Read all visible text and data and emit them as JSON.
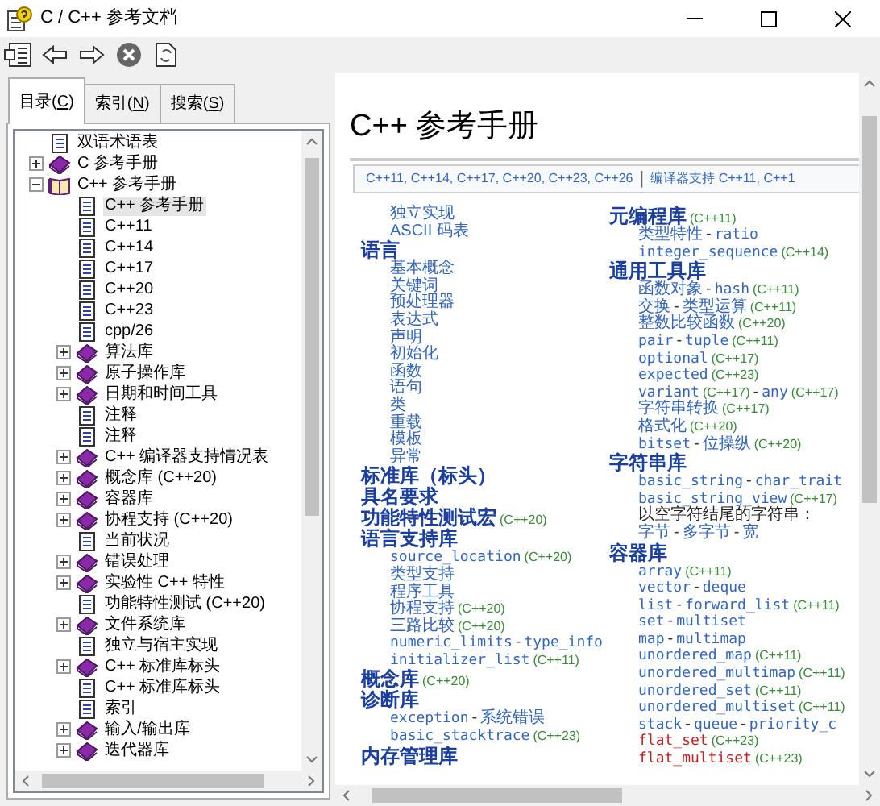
{
  "window": {
    "title": "C / C++ 参考文档"
  },
  "toolbar": {
    "buttons": [
      {
        "kind": "hide"
      },
      {
        "kind": "back"
      },
      {
        "kind": "forward"
      },
      {
        "kind": "stop"
      },
      {
        "kind": "refresh"
      }
    ]
  },
  "tabs": [
    {
      "before": "目录(",
      "key": "C",
      "after": ")",
      "selected": true
    },
    {
      "before": "索引(",
      "key": "N",
      "after": ")",
      "selected": false
    },
    {
      "before": "搜索(",
      "key": "S",
      "after": ")",
      "selected": false
    }
  ],
  "tree": [
    {
      "label": "双语术语表",
      "kind": "page",
      "selected": false
    },
    {
      "label": "C 参考手册",
      "kind": "book",
      "expanded": false,
      "selected": false
    },
    {
      "label": "C++ 参考手册",
      "kind": "book",
      "expanded": true,
      "selected": false,
      "children": [
        {
          "label": "C++ 参考手册",
          "kind": "page",
          "selected": true
        },
        {
          "label": "C++11",
          "kind": "page",
          "selected": false
        },
        {
          "label": "C++14",
          "kind": "page",
          "selected": false
        },
        {
          "label": "C++17",
          "kind": "page",
          "selected": false
        },
        {
          "label": "C++20",
          "kind": "page",
          "selected": false
        },
        {
          "label": "C++23",
          "kind": "page",
          "selected": false
        },
        {
          "label": "cpp/26",
          "kind": "page",
          "selected": false
        },
        {
          "label": "算法库",
          "kind": "book",
          "expanded": false,
          "selected": false
        },
        {
          "label": "原子操作库",
          "kind": "book",
          "expanded": false,
          "selected": false
        },
        {
          "label": "日期和时间工具",
          "kind": "book",
          "expanded": false,
          "selected": false
        },
        {
          "label": "注释",
          "kind": "page",
          "selected": false
        },
        {
          "label": "注释",
          "kind": "page",
          "selected": false
        },
        {
          "label": "C++ 编译器支持情况表",
          "kind": "book",
          "expanded": false,
          "selected": false
        },
        {
          "label": "概念库 (C++20)",
          "kind": "book",
          "expanded": false,
          "selected": false
        },
        {
          "label": "容器库",
          "kind": "book",
          "expanded": false,
          "selected": false
        },
        {
          "label": "协程支持 (C++20)",
          "kind": "book",
          "expanded": false,
          "selected": false
        },
        {
          "label": "当前状况",
          "kind": "page",
          "selected": false
        },
        {
          "label": "错误处理",
          "kind": "book",
          "expanded": false,
          "selected": false
        },
        {
          "label": "实验性 C++ 特性",
          "kind": "book",
          "expanded": false,
          "selected": false
        },
        {
          "label": "功能特性测试 (C++20)",
          "kind": "page",
          "selected": false
        },
        {
          "label": "文件系统库",
          "kind": "book",
          "expanded": false,
          "selected": false
        },
        {
          "label": "独立与宿主实现",
          "kind": "page",
          "selected": false
        },
        {
          "label": "C++ 标准库标头",
          "kind": "book",
          "expanded": false,
          "selected": false
        },
        {
          "label": "C++ 标准库标头",
          "kind": "page",
          "selected": false
        },
        {
          "label": "索引",
          "kind": "page",
          "selected": false
        },
        {
          "label": "输入/输出库",
          "kind": "book",
          "expanded": false,
          "selected": false
        },
        {
          "label": "迭代器库",
          "kind": "book",
          "expanded": false,
          "selected": false
        }
      ]
    }
  ],
  "page": {
    "title": "C++ 参考手册",
    "nav": {
      "versions": "C++11, C++14, C++17, C++20, C++23, C++26",
      "separator": "|",
      "compiler": "编译器支持 C++11, C++1"
    },
    "columns": [
      [
        {
          "kind": "item",
          "parts": [
            {
              "text": "独立实现",
              "kind": "link"
            }
          ]
        },
        {
          "kind": "item",
          "parts": [
            {
              "text": "ASCII 码表",
              "kind": "link"
            }
          ]
        },
        {
          "kind": "heading",
          "parts": [
            {
              "text": "语言",
              "kind": "link"
            }
          ]
        },
        {
          "kind": "item",
          "parts": [
            {
              "text": "基本概念",
              "kind": "link"
            }
          ]
        },
        {
          "kind": "item",
          "parts": [
            {
              "text": "关键词",
              "kind": "link"
            }
          ]
        },
        {
          "kind": "item",
          "parts": [
            {
              "text": "预处理器",
              "kind": "link"
            }
          ]
        },
        {
          "kind": "item",
          "parts": [
            {
              "text": "表达式",
              "kind": "link"
            }
          ]
        },
        {
          "kind": "item",
          "parts": [
            {
              "text": "声明",
              "kind": "link"
            }
          ]
        },
        {
          "kind": "item",
          "parts": [
            {
              "text": "初始化",
              "kind": "link"
            }
          ]
        },
        {
          "kind": "item",
          "parts": [
            {
              "text": "函数",
              "kind": "link"
            }
          ]
        },
        {
          "kind": "item",
          "parts": [
            {
              "text": "语句",
              "kind": "link"
            }
          ]
        },
        {
          "kind": "item",
          "parts": [
            {
              "text": "类",
              "kind": "link"
            }
          ]
        },
        {
          "kind": "item",
          "parts": [
            {
              "text": "重载",
              "kind": "link"
            }
          ]
        },
        {
          "kind": "item",
          "parts": [
            {
              "text": "模板",
              "kind": "link"
            }
          ]
        },
        {
          "kind": "item",
          "parts": [
            {
              "text": "异常",
              "kind": "link"
            }
          ]
        },
        {
          "kind": "heading",
          "parts": [
            {
              "text": "标准库（标头）",
              "kind": "link"
            }
          ]
        },
        {
          "kind": "heading",
          "parts": [
            {
              "text": "具名要求",
              "kind": "link"
            }
          ]
        },
        {
          "kind": "heading",
          "parts": [
            {
              "text": "功能特性测试宏",
              "kind": "link"
            },
            {
              "text": "(C++20)",
              "kind": "tag"
            }
          ]
        },
        {
          "kind": "heading",
          "parts": [
            {
              "text": "语言支持库",
              "kind": "link"
            }
          ]
        },
        {
          "kind": "item",
          "parts": [
            {
              "text": "source_location",
              "kind": "code"
            },
            {
              "text": "(C++20)",
              "kind": "tag"
            }
          ]
        },
        {
          "kind": "item",
          "parts": [
            {
              "text": "类型支持",
              "kind": "link"
            }
          ]
        },
        {
          "kind": "item",
          "parts": [
            {
              "text": "程序工具",
              "kind": "link"
            }
          ]
        },
        {
          "kind": "item",
          "parts": [
            {
              "text": "协程支持",
              "kind": "link"
            },
            {
              "text": "(C++20)",
              "kind": "tag"
            }
          ]
        },
        {
          "kind": "item",
          "parts": [
            {
              "text": "三路比较",
              "kind": "link"
            },
            {
              "text": "(C++20)",
              "kind": "tag"
            }
          ]
        },
        {
          "kind": "item",
          "parts": [
            {
              "text": "numeric_limits",
              "kind": "code"
            },
            {
              "text": "-",
              "kind": "sep"
            },
            {
              "text": "type_info",
              "kind": "code"
            }
          ]
        },
        {
          "kind": "item",
          "parts": [
            {
              "text": "initializer_list",
              "kind": "code"
            },
            {
              "text": "(C++11)",
              "kind": "tag"
            }
          ]
        },
        {
          "kind": "heading",
          "parts": [
            {
              "text": "概念库",
              "kind": "link"
            },
            {
              "text": "(C++20)",
              "kind": "tag"
            }
          ]
        },
        {
          "kind": "heading",
          "parts": [
            {
              "text": "诊断库",
              "kind": "link"
            }
          ]
        },
        {
          "kind": "item",
          "parts": [
            {
              "text": "exception",
              "kind": "code"
            },
            {
              "text": "-",
              "kind": "sep"
            },
            {
              "text": "系统错误",
              "kind": "link"
            }
          ]
        },
        {
          "kind": "item",
          "parts": [
            {
              "text": "basic_stacktrace",
              "kind": "code"
            },
            {
              "text": "(C++23)",
              "kind": "tag"
            }
          ]
        },
        {
          "kind": "heading",
          "parts": [
            {
              "text": "内存管理库",
              "kind": "link"
            }
          ]
        }
      ],
      [
        {
          "kind": "heading",
          "parts": [
            {
              "text": "元编程库",
              "kind": "link"
            },
            {
              "text": "(C++11)",
              "kind": "tag"
            }
          ]
        },
        {
          "kind": "item",
          "parts": [
            {
              "text": "类型特性",
              "kind": "link"
            },
            {
              "text": "-",
              "kind": "sep"
            },
            {
              "text": "ratio",
              "kind": "code"
            }
          ]
        },
        {
          "kind": "item",
          "parts": [
            {
              "text": "integer_sequence",
              "kind": "code"
            },
            {
              "text": "(C++14)",
              "kind": "tag"
            }
          ]
        },
        {
          "kind": "heading",
          "parts": [
            {
              "text": "通用工具库",
              "kind": "link"
            }
          ]
        },
        {
          "kind": "item",
          "parts": [
            {
              "text": "函数对象",
              "kind": "link"
            },
            {
              "text": "-",
              "kind": "sep"
            },
            {
              "text": "hash",
              "kind": "code"
            },
            {
              "text": "(C++11)",
              "kind": "tag"
            }
          ]
        },
        {
          "kind": "item",
          "parts": [
            {
              "text": "交换",
              "kind": "link"
            },
            {
              "text": "-",
              "kind": "sep"
            },
            {
              "text": "类型运算",
              "kind": "link"
            },
            {
              "text": "(C++11)",
              "kind": "tag"
            }
          ]
        },
        {
          "kind": "item",
          "parts": [
            {
              "text": "整数比较函数",
              "kind": "link"
            },
            {
              "text": "(C++20)",
              "kind": "tag"
            }
          ]
        },
        {
          "kind": "item",
          "parts": [
            {
              "text": "pair",
              "kind": "code"
            },
            {
              "text": "-",
              "kind": "sep"
            },
            {
              "text": "tuple",
              "kind": "code"
            },
            {
              "text": "(C++11)",
              "kind": "tag"
            }
          ]
        },
        {
          "kind": "item",
          "parts": [
            {
              "text": "optional",
              "kind": "code"
            },
            {
              "text": "(C++17)",
              "kind": "tag"
            }
          ]
        },
        {
          "kind": "item",
          "parts": [
            {
              "text": "expected",
              "kind": "code"
            },
            {
              "text": "(C++23)",
              "kind": "tag"
            }
          ]
        },
        {
          "kind": "item",
          "parts": [
            {
              "text": "variant",
              "kind": "code"
            },
            {
              "text": "(C++17)",
              "kind": "tag"
            },
            {
              "text": "-",
              "kind": "sep"
            },
            {
              "text": "any",
              "kind": "code"
            },
            {
              "text": "(C++17)",
              "kind": "tag"
            }
          ]
        },
        {
          "kind": "item",
          "parts": [
            {
              "text": "字符串转换",
              "kind": "link"
            },
            {
              "text": "(C++17)",
              "kind": "tag"
            }
          ]
        },
        {
          "kind": "item",
          "parts": [
            {
              "text": "格式化",
              "kind": "link"
            },
            {
              "text": "(C++20)",
              "kind": "tag"
            }
          ]
        },
        {
          "kind": "item",
          "parts": [
            {
              "text": "bitset",
              "kind": "code"
            },
            {
              "text": "-",
              "kind": "sep"
            },
            {
              "text": "位操纵",
              "kind": "link"
            },
            {
              "text": "(C++20)",
              "kind": "tag"
            }
          ]
        },
        {
          "kind": "heading",
          "parts": [
            {
              "text": "字符串库",
              "kind": "link"
            }
          ]
        },
        {
          "kind": "item",
          "parts": [
            {
              "text": "basic_string",
              "kind": "code"
            },
            {
              "text": "-",
              "kind": "sep"
            },
            {
              "text": "char_trait",
              "kind": "code"
            }
          ]
        },
        {
          "kind": "item",
          "parts": [
            {
              "text": "basic_string_view",
              "kind": "code"
            },
            {
              "text": "(C++17)",
              "kind": "tag"
            }
          ]
        },
        {
          "kind": "item",
          "parts": [
            {
              "text": "以空字符结尾的字符串：",
              "kind": "plain"
            }
          ]
        },
        {
          "kind": "item",
          "parts": [
            {
              "text": "字节",
              "kind": "link"
            },
            {
              "text": "-",
              "kind": "sep"
            },
            {
              "text": "多字节",
              "kind": "link"
            },
            {
              "text": "-",
              "kind": "sep"
            },
            {
              "text": "宽",
              "kind": "link"
            }
          ]
        },
        {
          "kind": "heading",
          "parts": [
            {
              "text": "容器库",
              "kind": "link"
            }
          ]
        },
        {
          "kind": "item",
          "parts": [
            {
              "text": "array",
              "kind": "code"
            },
            {
              "text": "(C++11)",
              "kind": "tag"
            }
          ]
        },
        {
          "kind": "item",
          "parts": [
            {
              "text": "vector",
              "kind": "code"
            },
            {
              "text": "-",
              "kind": "sep"
            },
            {
              "text": "deque",
              "kind": "code"
            }
          ]
        },
        {
          "kind": "item",
          "parts": [
            {
              "text": "list",
              "kind": "code"
            },
            {
              "text": "-",
              "kind": "sep"
            },
            {
              "text": "forward_list",
              "kind": "code"
            },
            {
              "text": "(C++11)",
              "kind": "tag"
            }
          ]
        },
        {
          "kind": "item",
          "parts": [
            {
              "text": "set",
              "kind": "code"
            },
            {
              "text": "-",
              "kind": "sep"
            },
            {
              "text": "multiset",
              "kind": "code"
            }
          ]
        },
        {
          "kind": "item",
          "parts": [
            {
              "text": "map",
              "kind": "code"
            },
            {
              "text": "-",
              "kind": "sep"
            },
            {
              "text": "multimap",
              "kind": "code"
            }
          ]
        },
        {
          "kind": "item",
          "parts": [
            {
              "text": "unordered_map",
              "kind": "code"
            },
            {
              "text": "(C++11)",
              "kind": "tag"
            }
          ]
        },
        {
          "kind": "item",
          "parts": [
            {
              "text": "unordered_multimap",
              "kind": "code"
            },
            {
              "text": "(C++11)",
              "kind": "tag"
            }
          ]
        },
        {
          "kind": "item",
          "parts": [
            {
              "text": "unordered_set",
              "kind": "code"
            },
            {
              "text": "(C++11)",
              "kind": "tag"
            }
          ]
        },
        {
          "kind": "item",
          "parts": [
            {
              "text": "unordered_multiset",
              "kind": "code"
            },
            {
              "text": "(C++11)",
              "kind": "tag"
            }
          ]
        },
        {
          "kind": "item",
          "parts": [
            {
              "text": "stack",
              "kind": "code"
            },
            {
              "text": "-",
              "kind": "sep"
            },
            {
              "text": "queue",
              "kind": "code"
            },
            {
              "text": "-",
              "kind": "sep"
            },
            {
              "text": "priority_c",
              "kind": "code"
            }
          ]
        },
        {
          "kind": "item",
          "parts": [
            {
              "text": "flat_set",
              "kind": "missing"
            },
            {
              "text": "(C++23)",
              "kind": "tag"
            }
          ]
        },
        {
          "kind": "item",
          "parts": [
            {
              "text": "flat_multiset",
              "kind": "missing"
            },
            {
              "text": "(C++23)",
              "kind": "tag"
            }
          ]
        }
      ]
    ]
  }
}
